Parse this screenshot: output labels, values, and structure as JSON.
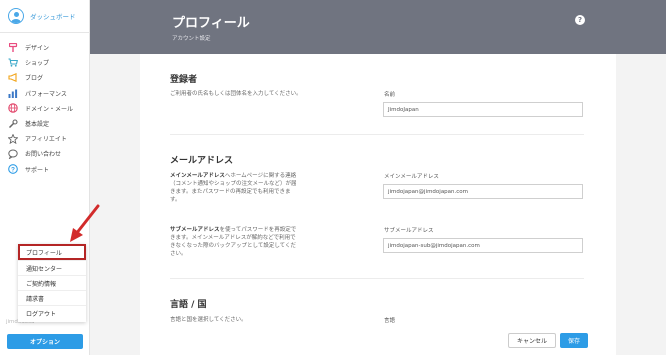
{
  "sidebar": {
    "dashboard_label": "ダッシュボード",
    "items": [
      {
        "label": "デザイン",
        "icon": "paint-roller-icon",
        "glyph": "⚲",
        "color": "#e94b7f"
      },
      {
        "label": "ショップ",
        "icon": "shopping-cart-icon",
        "glyph": "⛟",
        "color": "#3aa8c9"
      },
      {
        "label": "ブログ",
        "icon": "megaphone-icon",
        "glyph": "◁",
        "color": "#f1a316"
      },
      {
        "label": "パフォーマンス",
        "icon": "bar-chart-icon",
        "glyph": "▮",
        "color": "#3b78c6"
      },
      {
        "label": "ドメイン・メール",
        "icon": "globe-icon",
        "glyph": "◍",
        "color": "#e2456a"
      },
      {
        "label": "基本設定",
        "icon": "wrench-icon",
        "glyph": "✎",
        "color": "#666666"
      },
      {
        "label": "アフィリエイト",
        "icon": "star-icon",
        "glyph": "☆",
        "color": "#666666"
      },
      {
        "label": "お問い合わせ",
        "icon": "chat-bubble-icon",
        "glyph": "◯",
        "color": "#666666"
      },
      {
        "label": "サポート",
        "icon": "question-circle-icon",
        "glyph": "?",
        "color": "#2d9ce6"
      }
    ],
    "site_label": "jimdodesu",
    "options_button": "オプション"
  },
  "popup_menu": {
    "items": [
      "プロフィール",
      "通知センター",
      "ご契約情報",
      "請求書",
      "ログアウト"
    ]
  },
  "header": {
    "title": "プロフィール",
    "subtitle": "アカウント設定",
    "help_glyph": "?"
  },
  "registrant": {
    "title": "登録者",
    "description": "ご利用者の氏名もしくは団体名を入力してください。",
    "name_label": "名前",
    "name_value": "JimdoJapan"
  },
  "email": {
    "title": "メールアドレス",
    "main_desc_bold": "メインメールアドレス",
    "main_desc_rest": "へホームページに関する連絡（コメント通知やショップの注文メールなど）が届きます。またパスワードの再設定でも利用できます。",
    "main_label": "メインメールアドレス",
    "main_value": "jimdojapan@jimdojapan.com",
    "sub_desc_bold": "サブメールアドレス",
    "sub_desc_rest": "を使ってパスワードを再設定できます。メインメールアドレスが解約などで利用できなくなった際のバックアップとして設定してください。",
    "sub_label": "サブメールアドレス",
    "sub_value": "jimdojapan-sub@jimdojapan.com"
  },
  "language": {
    "title": "言語 / 国",
    "description": "言語と国を選択してください。",
    "field_label": "言語"
  },
  "footer": {
    "cancel": "キャンセル",
    "save": "保存"
  },
  "colors": {
    "accent": "#2d9ce6",
    "header_bg": "#707480",
    "highlight": "#b42525"
  }
}
